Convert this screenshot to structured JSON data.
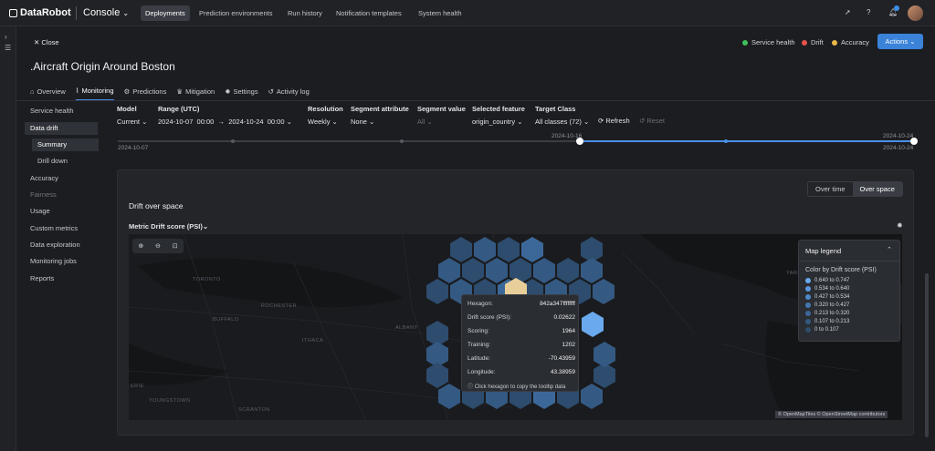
{
  "topbar": {
    "logo": "DataRobot",
    "product": "Console",
    "product_chevron": "⌄",
    "nav": [
      "Deployments",
      "Prediction environments",
      "Run history",
      "Notification templates",
      "System health"
    ]
  },
  "header": {
    "close_label": "Close",
    "title": ".Aircraft Origin Around Boston",
    "status": [
      {
        "label": "Service health",
        "color": "#3fbf5a"
      },
      {
        "label": "Drift",
        "color": "#e5534b"
      },
      {
        "label": "Accuracy",
        "color": "#e8b84b"
      }
    ],
    "actions_label": "Actions"
  },
  "tabs": [
    {
      "label": "Overview",
      "icon": "home-icon"
    },
    {
      "label": "Monitoring",
      "icon": "chart-icon",
      "active": true
    },
    {
      "label": "Predictions",
      "icon": "predictions-icon"
    },
    {
      "label": "Mitigation",
      "icon": "trophy-icon"
    },
    {
      "label": "Settings",
      "icon": "gear-icon"
    },
    {
      "label": "Activity log",
      "icon": "history-icon"
    }
  ],
  "sidenav": [
    {
      "label": "Service health"
    },
    {
      "label": "Data drift",
      "active": true
    },
    {
      "label": "Summary",
      "sub": true,
      "active": true
    },
    {
      "label": "Drill down",
      "sub": true
    },
    {
      "label": "Accuracy"
    },
    {
      "label": "Fairness",
      "disabled": true
    },
    {
      "label": "Usage"
    },
    {
      "label": "Custom metrics"
    },
    {
      "label": "Data exploration"
    },
    {
      "label": "Monitoring jobs"
    },
    {
      "label": "Reports"
    }
  ],
  "filters": {
    "model": {
      "label": "Model",
      "value": "Current"
    },
    "range": {
      "label": "Range (UTC)",
      "start": "2024-10-07",
      "start_time": "00:00",
      "end": "2024-10-24",
      "end_time": "00:00"
    },
    "resolution": {
      "label": "Resolution",
      "value": "Weekly"
    },
    "segment_attribute": {
      "label": "Segment attribute",
      "value": "None"
    },
    "segment_value": {
      "label": "Segment value",
      "value": "All"
    },
    "selected_feature": {
      "label": "Selected feature",
      "value": "origin_country"
    },
    "target_class": {
      "label": "Target Class",
      "value": "All classes (72)"
    },
    "refresh_label": "Refresh",
    "reset_label": "Reset"
  },
  "timeline": {
    "start_label": "2024-10-07",
    "sel_start_label": "2024-10-16",
    "sel_end_top": "2024-10-24",
    "sel_end_bottom": "2024-10-24"
  },
  "panel": {
    "view_toggle": [
      "Over time",
      "Over space"
    ],
    "active_view": "Over space",
    "title": "Drift over space",
    "metric_label": "Metric Drift score (PSI)"
  },
  "map": {
    "place_labels": [
      "TORONTO",
      "ROCHESTER",
      "BUFFALO",
      "ITHACA",
      "ALBANY",
      "YARMOUTH",
      "YOUNGSTOWN",
      "ERIE",
      "SCRANTON"
    ],
    "attribution": "© OpenMapTiles © OpenStreetMap contributors"
  },
  "tooltip": {
    "rows": [
      {
        "k": "Hexagon:",
        "v": "842a347ffffffff"
      },
      {
        "k": "Drift score (PSI):",
        "v": "0.02622"
      },
      {
        "k": "Scoring:",
        "v": "1964"
      },
      {
        "k": "Training:",
        "v": "1202"
      },
      {
        "k": "Latitude:",
        "v": "-70.43959"
      },
      {
        "k": "Longitude:",
        "v": "43.38959"
      }
    ],
    "hint": "Click hexagon to copy the tooltip data"
  },
  "legend": {
    "title": "Map legend",
    "subtitle": "Color by Drift score (PSI)",
    "items": [
      {
        "label": "0.640 to 0.747",
        "color": "#6aa9ee"
      },
      {
        "label": "0.534 to 0.640",
        "color": "#5b98db"
      },
      {
        "label": "0.427 to 0.534",
        "color": "#4f88c6"
      },
      {
        "label": "0.320 to 0.427",
        "color": "#4578b0"
      },
      {
        "label": "0.213 to 0.320",
        "color": "#3c6899"
      },
      {
        "label": "0.107 to 0.213",
        "color": "#345a83"
      },
      {
        "label": "0 to 0.107",
        "color": "#2d4c6e"
      }
    ]
  }
}
